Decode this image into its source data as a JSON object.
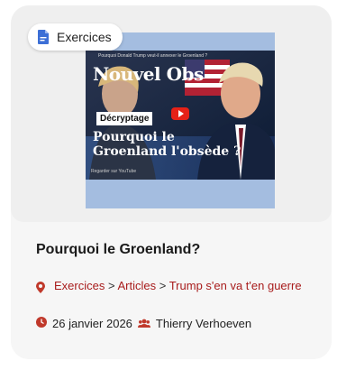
{
  "category": {
    "label": "Exercices",
    "icon": "document-icon"
  },
  "thumbnail": {
    "topline": "Pourquoi Donald Trump veut-il annexer le Groenland ?",
    "brand": "Nouvel Obs",
    "tag": "Décryptage",
    "headline": "Pourquoi le Groenland l'obsède ?",
    "footer": "Regarder sur YouTube",
    "colors": {
      "frame": "#a4bde0",
      "play": "#e62117"
    }
  },
  "article": {
    "title": "Pourquoi le Groenland?",
    "breadcrumb": {
      "items": [
        "Exercices",
        "Articles",
        "Trump s'en va t'en guerre"
      ],
      "separator": ">"
    },
    "date": "26 janvier 2026",
    "author": "Thierry Verhoeven"
  },
  "colors": {
    "accent": "#a81c1c",
    "card_bg": "#f6f6f6",
    "pill_icon": "#3c6fd6"
  }
}
